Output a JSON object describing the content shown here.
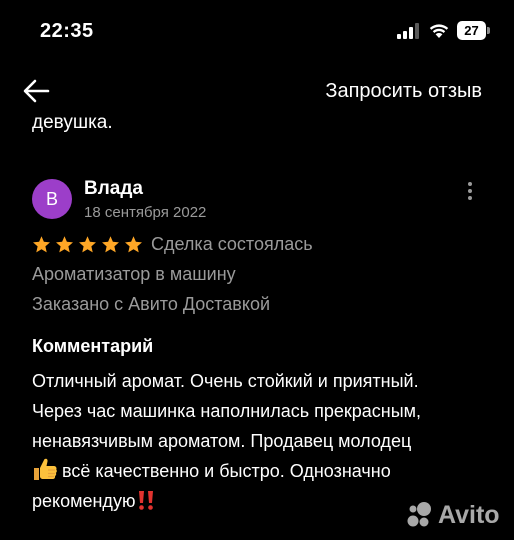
{
  "status_bar": {
    "time": "22:35",
    "battery": "27"
  },
  "nav": {
    "back_icon": "arrow-left-icon",
    "request_review_label": "Запросить отзыв"
  },
  "previous_review_tail": "девушка.",
  "review": {
    "avatar_letter": "В",
    "avatar_color": "#9c3ec9",
    "author": "Влада",
    "date": "18 сентября 2022",
    "rating": 5,
    "rating_max": 5,
    "star_color": "#ffa726",
    "deal_status": "Сделка состоялась",
    "product": "Ароматизатор в машину",
    "delivery": "Заказано с Авито Доставкой",
    "comment_heading": "Комментарий",
    "comment_lines": {
      "l1": "Отличный аромат. Очень стойкий и приятный.",
      "l2": "Через час машинка наполнилась прекрасным,",
      "l3": "ненавязчивым ароматом. Продавец молодец",
      "l4": "всё качественно и быстро. Однозначно",
      "l5": "рекомендую"
    },
    "emoji": {
      "thumbs_up": "thumbs-up-icon",
      "double_exclamation": "double-exclamation-icon"
    }
  },
  "watermark": {
    "brand": "Avito"
  },
  "colors": {
    "background": "#000000",
    "primary_text": "#ffffff",
    "secondary_text": "#9a9a9a"
  }
}
